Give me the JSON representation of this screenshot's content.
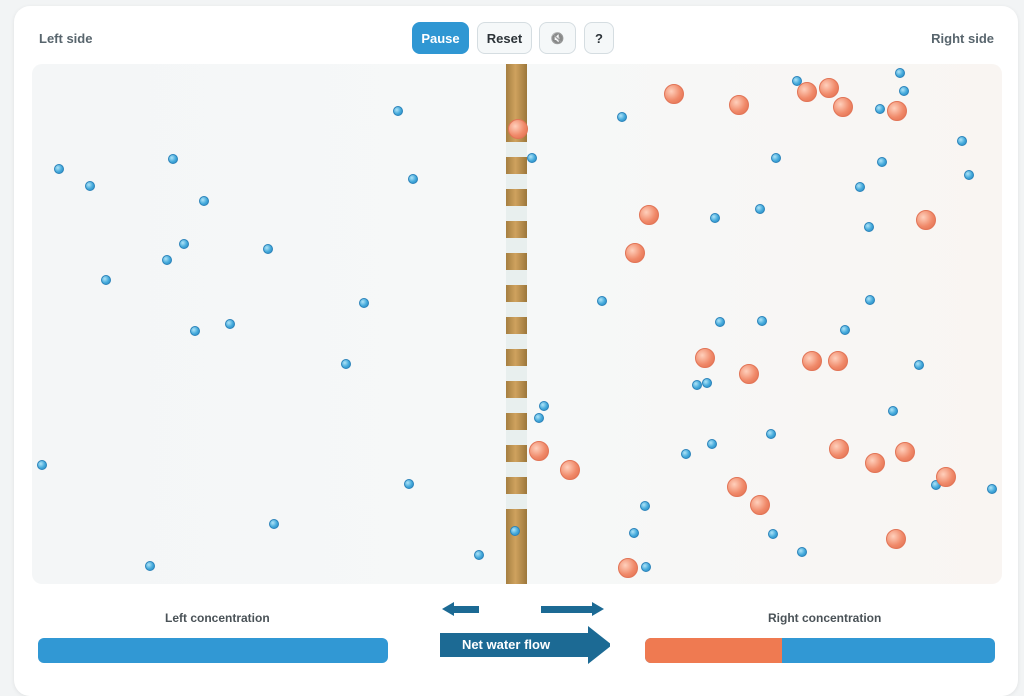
{
  "header": {
    "left_label": "Left side",
    "right_label": "Right side"
  },
  "controls": {
    "pause_label": "Pause",
    "reset_label": "Reset",
    "mute_icon": "mute-speaker-icon",
    "mute_glyph": "🔇",
    "help_label": "?"
  },
  "concentration": {
    "left_label": "Left concentration",
    "right_label": "Right concentration",
    "left_solute_fraction": 0.0,
    "right_solute_fraction": 0.39
  },
  "flow": {
    "net_label": "Net water flow",
    "direction": "right"
  },
  "colors": {
    "water": "#3198d4",
    "solute": "#ef7a51",
    "membrane": "#b8904e",
    "primary_button": "#2f97d3",
    "flow_arrow": "#1c6a94"
  }
}
